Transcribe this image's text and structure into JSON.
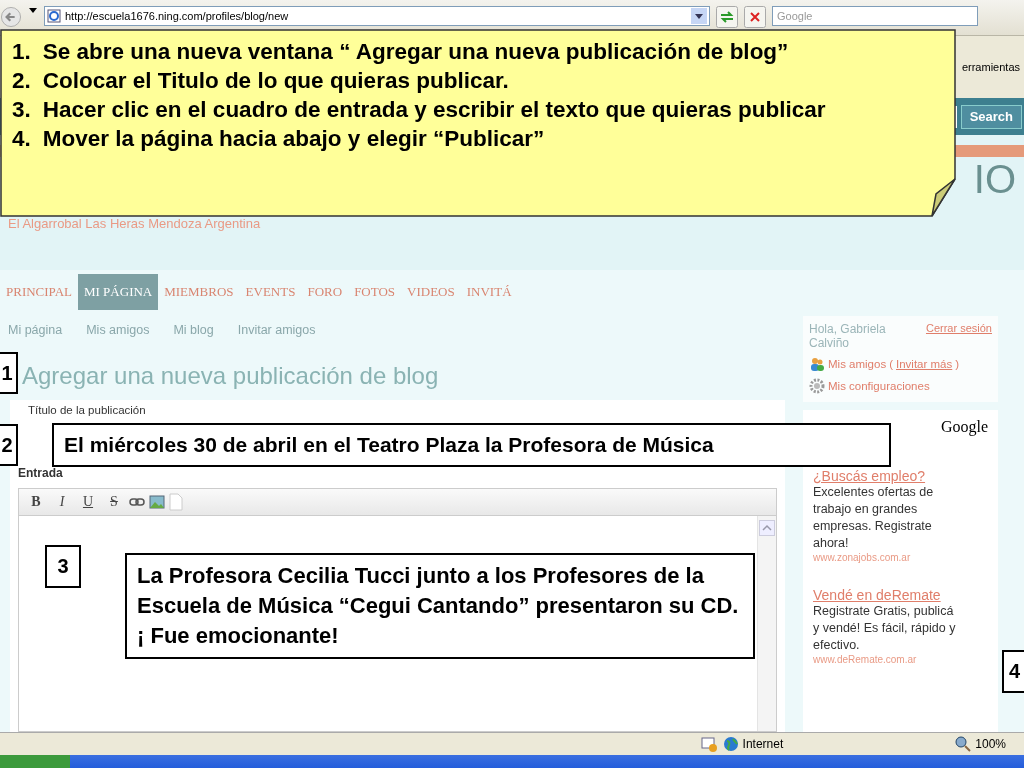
{
  "browser": {
    "url": "http://escuela1676.ning.com/profiles/blog/new",
    "search_placeholder": "Google",
    "menu_fragment": "erramientas",
    "search_button": "Search"
  },
  "site": {
    "title_fragment": "IO",
    "subtitle": "El Algarrobal Las Heras Mendoza Argentina"
  },
  "nav": [
    {
      "label": "PRINCIPAL",
      "selected": false
    },
    {
      "label": "MI PÁGINA",
      "selected": true
    },
    {
      "label": "MIEMBROS",
      "selected": false
    },
    {
      "label": "EVENTS",
      "selected": false
    },
    {
      "label": "FORO",
      "selected": false
    },
    {
      "label": "FOTOS",
      "selected": false
    },
    {
      "label": "VIDEOS",
      "selected": false
    },
    {
      "label": "INVITÁ",
      "selected": false
    }
  ],
  "subnav": [
    "Mi página",
    "Mis amigos",
    "Mi blog",
    "Invitar amigos"
  ],
  "page_title": "Agregar una nueva publicación de blog",
  "form": {
    "title_label": "Título de la publicación",
    "title_value": "El miércoles 30 de abril en el Teatro Plaza la Profesora de Música",
    "entry_label": "Entrada",
    "entry_text": "La Profesora Cecilia Tucci junto a los Profesores de la Escuela de Música “Cegui Cantando” presentaron su CD. ¡ Fue emocionante!"
  },
  "sidebar": {
    "greeting": "Hola, Gabriela Calviño",
    "logout": "Cerrar sesión",
    "friends": "Mis amigos",
    "invite_open": "(",
    "invite": "Invitar más",
    "invite_close": ")",
    "settings": "Mis configuraciones",
    "ads_label": "Google",
    "ads": [
      {
        "title": "¿Buscás empleo?",
        "body": "Excelentes ofertas de trabajo en grandes empresas. Registrate ahora!",
        "url": "www.zonajobs.com.ar"
      },
      {
        "title": "Vendé en deRemate",
        "body": "Registrate Gratis, publicá y vendé! Es fácil, rápido y efectivo.",
        "url": "www.deRemate.com.ar"
      }
    ]
  },
  "callout": {
    "steps": [
      {
        "number": "1.",
        "text": "Se abre una nueva ventana “ Agregar una nueva publicación de blog”"
      },
      {
        "number": "2.",
        "text": "Colocar el Titulo de lo que quieras publicar."
      },
      {
        "number": "3.",
        "text": "Hacer clic en el cuadro de entrada y escribir el texto que quieras publicar"
      },
      {
        "number": "4.",
        "text": "Mover la página hacia abajo y elegir “Publicar”"
      }
    ]
  },
  "format_buttons": [
    "B",
    "I",
    "U",
    "S"
  ],
  "markers": {
    "heading": "1",
    "title": "2",
    "entry": "3",
    "sidebar": "4"
  },
  "status_bar": {
    "zone": "Internet",
    "zoom": "100%"
  }
}
